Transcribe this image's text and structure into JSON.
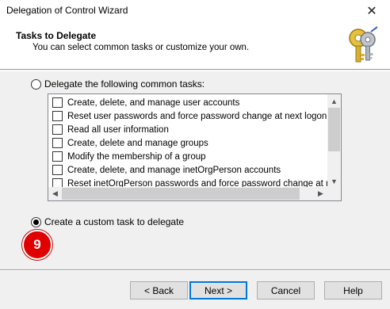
{
  "window": {
    "title": "Delegation of Control Wizard",
    "close_glyph": "✕"
  },
  "header": {
    "title": "Tasks to Delegate",
    "subtitle": "You can select common tasks or customize your own.",
    "icon": "keys-icon"
  },
  "options": {
    "common_label": "Delegate the following common tasks:",
    "common_selected": false,
    "custom_label": "Create a custom task to delegate",
    "custom_selected": true
  },
  "tasks": [
    {
      "label": "Create, delete, and manage user accounts",
      "checked": false
    },
    {
      "label": "Reset user passwords and force password change at next logon",
      "checked": false
    },
    {
      "label": "Read all user information",
      "checked": false
    },
    {
      "label": "Create, delete and manage groups",
      "checked": false
    },
    {
      "label": "Modify the membership of a group",
      "checked": false
    },
    {
      "label": "Create, delete, and manage inetOrgPerson accounts",
      "checked": false
    },
    {
      "label": "Reset inetOrgPerson passwords and force password change at next lo",
      "checked": false
    }
  ],
  "step_badge": "9",
  "buttons": {
    "back": "< Back",
    "next": "Next >",
    "cancel": "Cancel",
    "help": "Help"
  },
  "colors": {
    "badge": "#e00000",
    "accent": "#0078d7"
  }
}
